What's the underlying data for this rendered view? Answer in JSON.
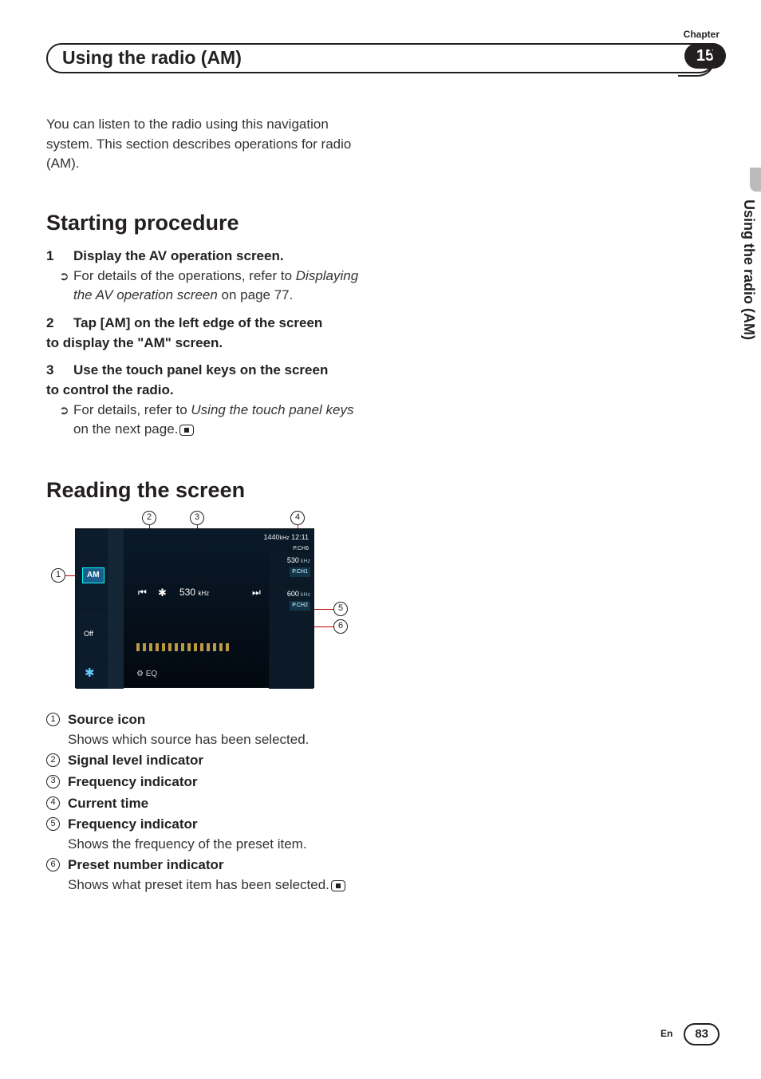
{
  "chapter": {
    "label": "Chapter",
    "number": "15"
  },
  "section_title": "Using the radio (AM)",
  "intro": "You can listen to the radio using this navigation system. This section describes operations for radio (AM).",
  "side_text": "Using the radio (AM)",
  "h_start": "Starting procedure",
  "steps": {
    "s1": {
      "num": "1",
      "text": "Display the AV operation screen."
    },
    "s1_sub_a": "For details of the operations, refer to ",
    "s1_sub_i": "Displaying the AV operation screen",
    "s1_sub_b": " on page 77.",
    "s2_a": {
      "num": "2",
      "text": "Tap [AM] on the left edge of the screen"
    },
    "s2_b": "to display the \"AM\" screen.",
    "s3_a": {
      "num": "3",
      "text": "Use the touch panel keys on the screen"
    },
    "s3_b": "to control the radio.",
    "s3_sub_a": "For details, refer to ",
    "s3_sub_i": "Using the touch panel keys",
    "s3_sub_b": " on the next page."
  },
  "h_reading": "Reading the screen",
  "screen": {
    "am_label": "AM",
    "off_label": "Off",
    "top_freq": "1440",
    "top_time": "12:11",
    "top_pch": "P.CH6",
    "main_freq": "530",
    "main_unit": "kHz",
    "prev": "⏮",
    "local": "✱",
    "next": "⏭",
    "bottom_icons": "⚙   EQ",
    "bt": "✱",
    "presets": [
      {
        "freq": "530",
        "unit": "kHz",
        "ch": "P.CH1"
      },
      {
        "freq": "600",
        "unit": "kHz",
        "ch": "P.CH2"
      }
    ],
    "top_unit": "kHz"
  },
  "callout_nums": {
    "c1": "1",
    "c2": "2",
    "c3": "3",
    "c4": "4",
    "c5": "5",
    "c6": "6"
  },
  "callouts": [
    {
      "n": "1",
      "title": "Source icon",
      "desc": "Shows which source has been selected."
    },
    {
      "n": "2",
      "title": "Signal level indicator",
      "desc": ""
    },
    {
      "n": "3",
      "title": "Frequency indicator",
      "desc": ""
    },
    {
      "n": "4",
      "title": "Current time",
      "desc": ""
    },
    {
      "n": "5",
      "title": "Frequency indicator",
      "desc": "Shows the frequency of the preset item."
    },
    {
      "n": "6",
      "title": "Preset number indicator",
      "desc": "Shows what preset item has been selected."
    }
  ],
  "footer": {
    "lang": "En",
    "page": "83"
  }
}
